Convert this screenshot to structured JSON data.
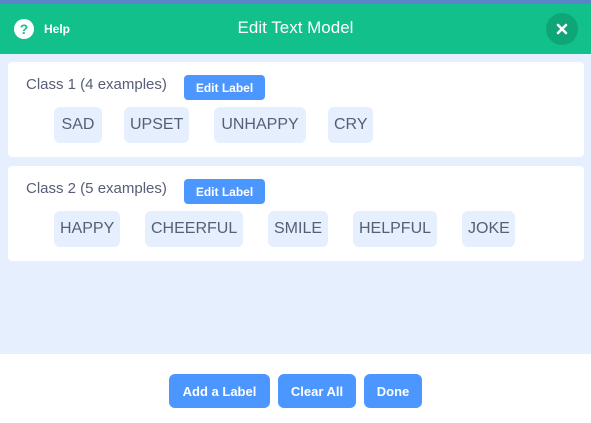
{
  "header": {
    "help_label": "Help",
    "help_glyph": "?",
    "title": "Edit Text Model",
    "accent_color": "#11c08b"
  },
  "classes": [
    {
      "title": "Class 1 (4 examples)",
      "edit_label": "Edit Label",
      "examples": [
        "SAD",
        "UPSET",
        "UNHAPPY",
        "CRY"
      ]
    },
    {
      "title": "Class 2 (5 examples)",
      "edit_label": "Edit Label",
      "examples": [
        "HAPPY",
        "CHEERFUL",
        "SMILE",
        "HELPFUL",
        "JOKE"
      ]
    }
  ],
  "footer": {
    "add_label": "Add a Label",
    "clear_all": "Clear All",
    "done": "Done",
    "button_color": "#4c97ff"
  },
  "icons": {
    "help": "help-icon",
    "close": "close-icon"
  }
}
